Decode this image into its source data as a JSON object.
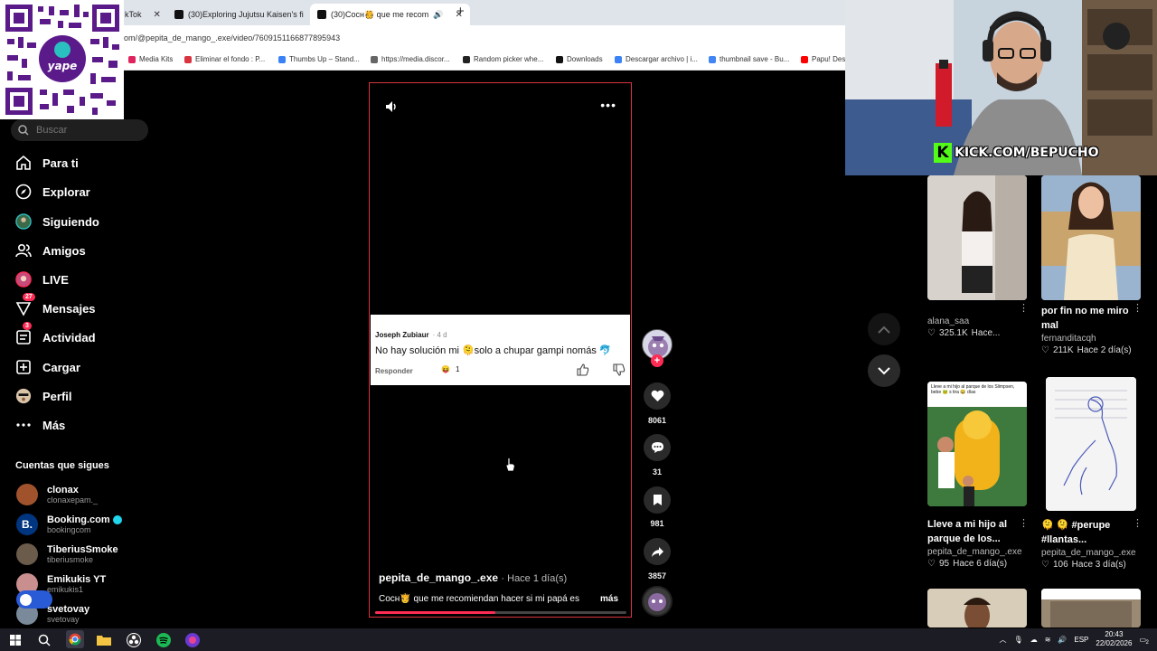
{
  "browser": {
    "tabs": [
      {
        "title": "kTok"
      },
      {
        "title": "(30)Exploring Jujutsu Kaisen's fi"
      },
      {
        "title": "(30)Cocн🫅 que me recom"
      }
    ],
    "new_tab": "+",
    "url": "om/@pepita_de_mango_.exe/video/7609151166877895943",
    "bookmarks": [
      {
        "label": "Media Kits",
        "color": "#e0245e"
      },
      {
        "label": "Eliminar el fondo : P...",
        "color": "#d9343f"
      },
      {
        "label": "Thumbs Up – Stand...",
        "color": "#3b82f6"
      },
      {
        "label": "https://media.discor...",
        "color": "#666666"
      },
      {
        "label": "Random picker whe...",
        "color": "#222222"
      },
      {
        "label": "Downloads",
        "color": "#111111"
      },
      {
        "label": "Descargar archivo | i...",
        "color": "#3b82f6"
      },
      {
        "label": "thumbnail save - Bu...",
        "color": "#4285f4"
      },
      {
        "label": "Papu! Des",
        "color": "#ff0000"
      }
    ]
  },
  "qr": {
    "brand": "yape"
  },
  "sidebar": {
    "search_placeholder": "Buscar",
    "nav": [
      {
        "label": "Para ti",
        "icon": "home-icon"
      },
      {
        "label": "Explorar",
        "icon": "compass-icon"
      },
      {
        "label": "Siguiendo",
        "icon": "following-avatar-icon"
      },
      {
        "label": "Amigos",
        "icon": "friends-icon"
      },
      {
        "label": "LIVE",
        "icon": "live-icon"
      },
      {
        "label": "Mensajes",
        "icon": "messages-icon",
        "badge": "27"
      },
      {
        "label": "Actividad",
        "icon": "activity-icon",
        "badge": "3"
      },
      {
        "label": "Cargar",
        "icon": "upload-icon"
      },
      {
        "label": "Perfil",
        "icon": "profile-icon"
      },
      {
        "label": "Más",
        "icon": "more-icon"
      }
    ],
    "following_title": "Cuentas que sigues",
    "following": [
      {
        "name": "clonax",
        "handle": "clonaxepam._",
        "color": "#a0522d"
      },
      {
        "name": "Booking.com",
        "handle": "bookingcom",
        "color": "#003580",
        "verified": true
      },
      {
        "name": "TiberiusSmoke",
        "handle": "tiberiusmoke",
        "color": "#6b5b4b"
      },
      {
        "name": "Emikukis YT",
        "handle": "emikukis1",
        "color": "#c98e8e"
      },
      {
        "name": "svetovay",
        "handle": "svetovay",
        "color": "#7a8a9a"
      }
    ]
  },
  "video": {
    "comment": {
      "author": "Joseph Zubiaur",
      "time": "· 4 d",
      "text": "No hay solución mi 🫠solo a chupar gampi nomás 🐬",
      "reply": "Responder",
      "reaction_count": "1"
    },
    "username": "pepita_de_mango_.exe",
    "posted": "· Hace 1 día(s)",
    "description": "Cocн🫅 que me recomiendan hacer si mi papá es",
    "more": "más",
    "progress": 0.48
  },
  "actions": {
    "likes": "8061",
    "comments": "31",
    "saves": "981",
    "shares": "3857"
  },
  "webcam": {
    "overlay_text": "KICK.COM/BEPUCHO",
    "logo_letter": "K"
  },
  "grid": [
    {
      "title": "",
      "user": "alana_saa",
      "likes": "325.1K",
      "time": "Hace...",
      "bg": "#c9c3c0"
    },
    {
      "title": "por fin no me miro\nmal",
      "user": "fernanditacqh",
      "likes": "211K",
      "time": "Hace 2 día(s)",
      "bg": "#8aa5c2"
    },
    {
      "title": "Lleve a mi hijo al\nparque de los...",
      "user": "pepita_de_mango_.exe",
      "likes": "95",
      "time": "Hace 6 día(s)",
      "bg": "#3a6a3a",
      "thumb_caption": "Lleve a mi hijo al parque de los Slimpsen, bebe 🐸 s tira 😂 días"
    },
    {
      "title": "🫠 🫠 #perupe\n#llantas...",
      "user": "pepita_de_mango_.exe",
      "likes": "106",
      "time": "Hace 3 día(s)",
      "bg": "#e8e8e8"
    }
  ],
  "taskbar": {
    "lang": "ESP",
    "time": "20:43",
    "date": "22/02/2026",
    "notifications": "2"
  }
}
